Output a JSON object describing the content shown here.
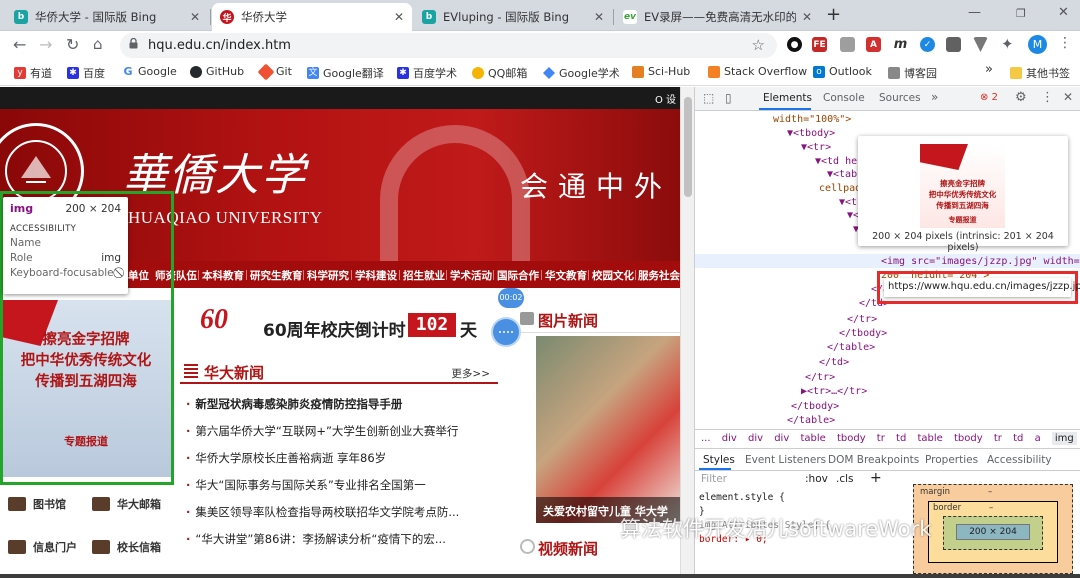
{
  "browser": {
    "tabs": [
      {
        "title": "华侨大学 - 国际版 Bing",
        "active": false
      },
      {
        "title": "华侨大学",
        "active": true
      },
      {
        "title": "EVluping - 国际版 Bing",
        "active": false
      },
      {
        "title": "EV录屏——免费高清无水印的屏",
        "active": false
      }
    ],
    "new_tab": "+",
    "url": "hqu.edu.cn/index.htm",
    "profile_initial": "M",
    "extensions": [
      "FE"
    ],
    "bookmarks": [
      {
        "label": "有道",
        "color": "#e53935"
      },
      {
        "label": "百度",
        "color": "#2932e1"
      },
      {
        "label": "Google",
        "color": "#4285f4"
      },
      {
        "label": "GitHub",
        "color": "#24292e"
      },
      {
        "label": "Git",
        "color": "#f05133"
      },
      {
        "label": "Google翻译",
        "color": "#4285f4"
      },
      {
        "label": "百度学术",
        "color": "#2932e1"
      },
      {
        "label": "QQ邮箱",
        "color": "#f4b400"
      },
      {
        "label": "Google学术",
        "color": "#4285f4"
      },
      {
        "label": "Sci-Hub",
        "color": "#e67e22"
      },
      {
        "label": "Stack Overflow",
        "color": "#f48024"
      },
      {
        "label": "Outlook",
        "color": "#0078d4"
      },
      {
        "label": "博客园",
        "color": "#888888"
      }
    ],
    "bookmarks_more": "»",
    "other_bookmarks": "其他书签"
  },
  "page": {
    "banner": {
      "school_cn": "華僑大学",
      "school_en": "HUAQIAO UNIVERSITY",
      "motto": "会通中外",
      "logo_text": "HUAQIAO UNIVERSITY"
    },
    "top_right": "O 设",
    "nav": [
      "单位",
      "师资队伍",
      "本科教育",
      "研究生教育",
      "科学研究",
      "学科建设",
      "招生就业",
      "学术活动",
      "国际合作",
      "华文教育",
      "校园文化",
      "服务社会"
    ],
    "ad": {
      "lines": [
        "擦亮金字招牌",
        "把中华优秀传统文化",
        "传播到五湖四海"
      ],
      "foot": "专题报道"
    },
    "tooltip": {
      "tag": "img",
      "size": "200 × 204",
      "section": "ACCESSIBILITY",
      "rows": [
        {
          "k": "Name",
          "v": ""
        },
        {
          "k": "Role",
          "v": "img"
        },
        {
          "k": "Keyboard-focusable",
          "v": "⃠"
        }
      ]
    },
    "quick_links": [
      {
        "label": "图书馆"
      },
      {
        "label": "华大邮箱"
      },
      {
        "label": "信息门户"
      },
      {
        "label": "校长信箱"
      }
    ],
    "countdown": {
      "logo": "60",
      "text": "60周年校庆倒计时",
      "days": "102",
      "unit": "天"
    },
    "news": {
      "title": "华大新闻",
      "more": "更多>>",
      "items": [
        {
          "text": "新型冠状病毒感染肺炎疫情防控指导手册",
          "bold": true
        },
        {
          "text": "第六届华侨大学“互联网+”大学生创新创业大赛举行",
          "bold": false
        },
        {
          "text": "华侨大学原校长庄善裕病逝 享年86岁",
          "bold": false
        },
        {
          "text": "华大“国际事务与国际关系”专业排名全国第一",
          "bold": false
        },
        {
          "text": "集美区领导率队检查指导两校联招华文学院考点防...",
          "bold": false
        },
        {
          "text": "“华大讲堂”第86讲：李扬解读分析“疫情下的宏...",
          "bold": false
        }
      ]
    },
    "photo": {
      "title": "图片新闻",
      "caption": "关爱农村留守儿童 华大学"
    },
    "video": {
      "title": "视频新闻"
    },
    "timer": "00:02"
  },
  "devtools": {
    "tabs": [
      "Elements",
      "Console",
      "Sources",
      "»"
    ],
    "errors": "2",
    "dom_lines": [
      {
        "indent": 6,
        "html": "width=\"100%\">"
      },
      {
        "indent": 7,
        "html": "▼<tbody>"
      },
      {
        "indent": 8,
        "html": "▼<tr>"
      },
      {
        "indent": 9,
        "html": "▼<td heig"
      },
      {
        "indent": 10,
        "html": "▼<table"
      },
      {
        "indent": 10,
        "html": "cellpad"
      },
      {
        "indent": 11,
        "html": "▼<tbo"
      },
      {
        "indent": 12,
        "html": "▼<t"
      },
      {
        "indent": 13,
        "html": "▼<"
      },
      {
        "indent": 14,
        "html": "<img src=\"images/jzzp.jpg\" width="
      },
      {
        "indent": 14,
        "html": "200\" height=\"204\">"
      },
      {
        "indent": 13,
        "html": "</a>"
      },
      {
        "indent": 12,
        "html": "</td>"
      },
      {
        "indent": 11,
        "html": "</tr>"
      },
      {
        "indent": 10,
        "html": "</tbody>"
      },
      {
        "indent": 9,
        "html": "</table>"
      },
      {
        "indent": 8,
        "html": "</td>"
      },
      {
        "indent": 7,
        "html": "</tr>"
      },
      {
        "indent": 7,
        "html": "▶<tr>…</tr>"
      },
      {
        "indent": 6,
        "html": "</tbody>"
      },
      {
        "indent": 5,
        "html": "</table>"
      }
    ],
    "preview_caption": "200 × 204 pixels (intrinsic: 201 × 204 pixels)",
    "url_tip": "https://www.hqu.edu.cn/images/jzzp.jpg",
    "preview_lines": [
      "擦亮金字招牌",
      "把中华优秀传统文化",
      "传播到五湖四海",
      "专题报道"
    ],
    "breadcrumbs": [
      "...",
      "div",
      "div",
      "div",
      "table",
      "tbody",
      "tr",
      "td",
      "table",
      "tbody",
      "tr",
      "td",
      "a",
      "img"
    ],
    "style_tabs": [
      "Styles",
      "Event Listeners",
      "DOM Breakpoints",
      "Properties",
      "Accessibility"
    ],
    "filter_placeholder": "Filter",
    "hov": ":hov",
    "cls": ".cls",
    "plus": "+",
    "css_rules": [
      "element.style {",
      "}",
      "img[Attributes Style] {",
      "  border: ▸ 0;"
    ],
    "boxmodel": {
      "margin": "margin",
      "border": "border",
      "padding": "padding",
      "content": "200 × 204",
      "dash": "–"
    }
  },
  "watermark": "算法软件开发活儿softwareWork"
}
